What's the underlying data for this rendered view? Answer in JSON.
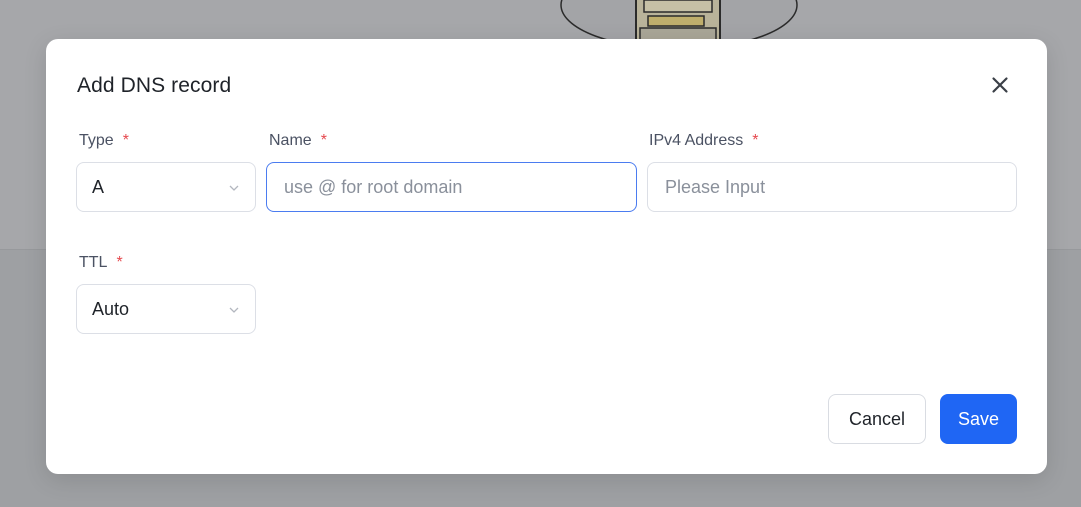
{
  "dialog": {
    "title": "Add DNS record"
  },
  "fields": {
    "type": {
      "label": "Type",
      "required_mark": "*",
      "value": "A"
    },
    "name": {
      "label": "Name",
      "required_mark": "*",
      "placeholder": "use @ for root domain",
      "value": ""
    },
    "ipv4": {
      "label": "IPv4 Address",
      "required_mark": "*",
      "placeholder": "Please Input",
      "value": ""
    },
    "ttl": {
      "label": "TTL",
      "required_mark": "*",
      "value": "Auto"
    }
  },
  "actions": {
    "cancel_label": "Cancel",
    "save_label": "Save"
  },
  "colors": {
    "accent": "#1f66f4",
    "required": "#e5484d",
    "focus_border": "#4b7cf0"
  },
  "icons": {
    "close": "close-icon",
    "select_arrow": "chevron-down-icon"
  }
}
